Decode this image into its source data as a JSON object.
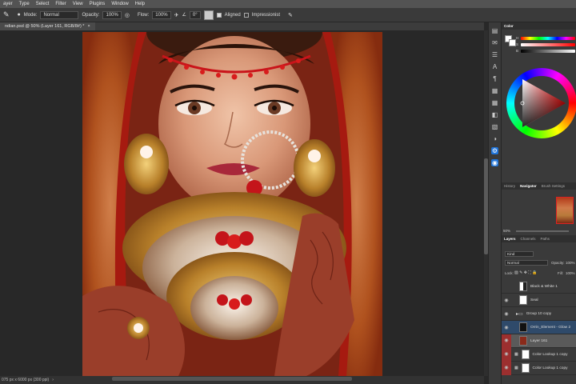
{
  "menu": [
    "ayer",
    "Type",
    "Select",
    "Filter",
    "View",
    "Plugins",
    "Window",
    "Help"
  ],
  "options": {
    "mode_label": "Mode:",
    "mode_value": "Normal",
    "opacity_label": "Opacity:",
    "opacity_value": "100%",
    "flow_label": "Flow:",
    "flow_value": "100%",
    "angle_value": "0°",
    "aligned_label": "Aligned",
    "impressionist_label": "Impressionist"
  },
  "document": {
    "tab_title": "ndian.psd @ 50% (Layer 161, RGB/8#) *",
    "status": "075 px x 6000 px (300 ppi)"
  },
  "color_panel": {
    "tab": "Color",
    "h_label": "H",
    "s_label": "S",
    "b_label": "B"
  },
  "navigator": {
    "tabs": [
      "History",
      "Navigator",
      "Brush Settings"
    ],
    "active_tab": "Navigator",
    "zoom": "50%"
  },
  "layers": {
    "tabs": [
      "Layers",
      "Channels",
      "Paths"
    ],
    "active_tab": "Layers",
    "filter_kind": "Kind",
    "blend_mode": "Normal",
    "opacity_label": "Opacity:",
    "opacity_value": "100%",
    "lock_label": "Lock:",
    "fill_label": "Fill:",
    "fill_value": "100%",
    "items": [
      {
        "name": "Black & White 1",
        "visible": false
      },
      {
        "name": "Seal",
        "visible": true
      },
      {
        "name": "Group 10 copy",
        "visible": true
      },
      {
        "name": "Orrin_Element - Glow 2",
        "visible": true
      },
      {
        "name": "Layer 161",
        "visible": true
      },
      {
        "name": "Color Lookup 1 copy",
        "visible": true
      },
      {
        "name": "Color Lookup 1 copy",
        "visible": true
      }
    ]
  },
  "colors": {
    "accent": "#1e73d9",
    "tag_red": "#9c2f2f"
  }
}
